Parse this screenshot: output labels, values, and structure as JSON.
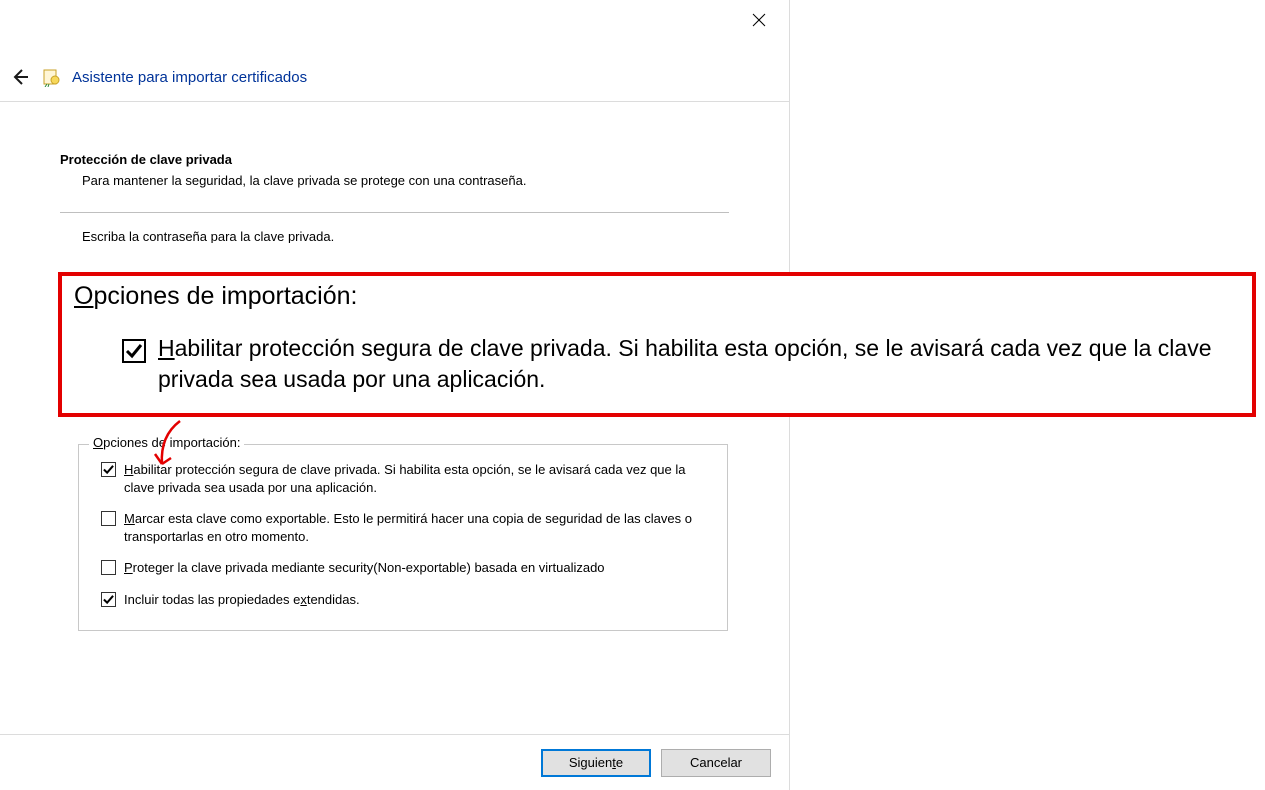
{
  "header": {
    "title": "Asistente para importar certificados"
  },
  "section": {
    "title": "Protección de clave privada",
    "description": "Para mantener la seguridad, la clave privada se protege con una contraseña.",
    "truncated": "Escriba la contraseña para la clave privada."
  },
  "callout": {
    "title_prefix": "O",
    "title_rest": "pciones de importación:",
    "check_prefix": "H",
    "check_rest": "abilitar protección segura de clave privada. Si habilita esta opción, se le avisará cada vez que la clave privada sea usada por una aplicación."
  },
  "group": {
    "legend_prefix": "O",
    "legend_rest": "pciones de importación:",
    "options": [
      {
        "checked": true,
        "prefix": "H",
        "rest": "abilitar protección segura de clave privada. Si habilita esta opción, se le avisará cada vez que la clave privada sea usada por una aplicación."
      },
      {
        "checked": false,
        "prefix": "M",
        "rest": "arcar esta clave como exportable. Esto le permitirá hacer una copia de seguridad de las claves o transportarlas en otro momento."
      },
      {
        "checked": false,
        "prefix": "P",
        "rest": "roteger la clave privada mediante security(Non-exportable) basada en virtualizado"
      },
      {
        "checked": true,
        "prefix": "",
        "rest": "Incluir todas las propiedades e",
        "mid_u": "x",
        "tail": "tendidas."
      }
    ]
  },
  "footer": {
    "next_prefix": "Siguien",
    "next_u": "t",
    "next_rest": "e",
    "cancel": "Cancelar"
  }
}
